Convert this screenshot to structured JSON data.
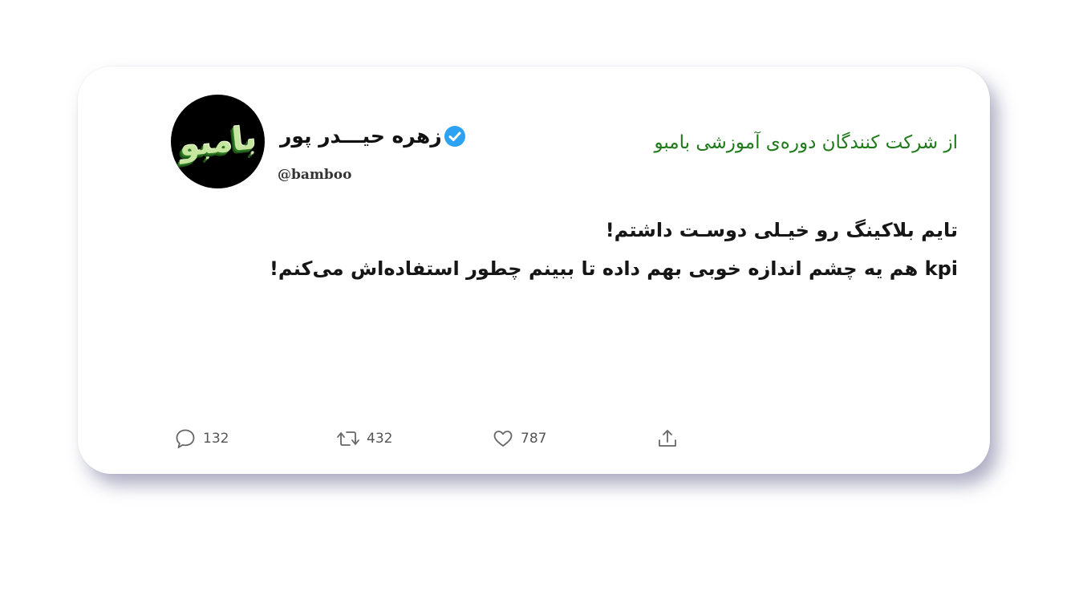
{
  "tweet": {
    "author": {
      "name": "زهره حیـــدر پور",
      "handle": "@bamboo",
      "avatar_text": "بامبو",
      "verified": true
    },
    "tagline": "از شرکت کنندگان دوره‌ی آموزشی بامبو",
    "body_lines": [
      "تایم بلاکینگ رو خیـلی دوسـت داشتم!",
      "kpi هم یه چشم اندازه خوبی بهم داده تا ببینم چطور استفاده‌اش می‌کنم!"
    ],
    "stats": {
      "replies": "132",
      "retweets": "432",
      "likes": "787"
    }
  },
  "icons": {
    "verified": "verified-badge-icon",
    "reply": "reply-bubble-icon",
    "retweet": "retweet-icon",
    "like": "heart-icon",
    "share": "share-icon"
  },
  "colors": {
    "verified": "#2da1f2",
    "tagline": "#1f7a1a",
    "text": "#161616",
    "muted": "#555555"
  }
}
